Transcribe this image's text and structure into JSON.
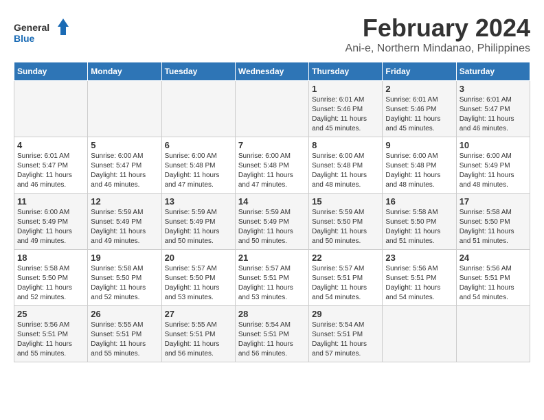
{
  "logo": {
    "text_general": "General",
    "text_blue": "Blue"
  },
  "title": "February 2024",
  "subtitle": "Ani-e, Northern Mindanao, Philippines",
  "calendar": {
    "headers": [
      "Sunday",
      "Monday",
      "Tuesday",
      "Wednesday",
      "Thursday",
      "Friday",
      "Saturday"
    ],
    "weeks": [
      {
        "days": [
          {
            "day": "",
            "info": ""
          },
          {
            "day": "",
            "info": ""
          },
          {
            "day": "",
            "info": ""
          },
          {
            "day": "",
            "info": ""
          },
          {
            "day": "1",
            "info": "Sunrise: 6:01 AM\nSunset: 5:46 PM\nDaylight: 11 hours\nand 45 minutes."
          },
          {
            "day": "2",
            "info": "Sunrise: 6:01 AM\nSunset: 5:46 PM\nDaylight: 11 hours\nand 45 minutes."
          },
          {
            "day": "3",
            "info": "Sunrise: 6:01 AM\nSunset: 5:47 PM\nDaylight: 11 hours\nand 46 minutes."
          }
        ]
      },
      {
        "days": [
          {
            "day": "4",
            "info": "Sunrise: 6:01 AM\nSunset: 5:47 PM\nDaylight: 11 hours\nand 46 minutes."
          },
          {
            "day": "5",
            "info": "Sunrise: 6:00 AM\nSunset: 5:47 PM\nDaylight: 11 hours\nand 46 minutes."
          },
          {
            "day": "6",
            "info": "Sunrise: 6:00 AM\nSunset: 5:48 PM\nDaylight: 11 hours\nand 47 minutes."
          },
          {
            "day": "7",
            "info": "Sunrise: 6:00 AM\nSunset: 5:48 PM\nDaylight: 11 hours\nand 47 minutes."
          },
          {
            "day": "8",
            "info": "Sunrise: 6:00 AM\nSunset: 5:48 PM\nDaylight: 11 hours\nand 48 minutes."
          },
          {
            "day": "9",
            "info": "Sunrise: 6:00 AM\nSunset: 5:48 PM\nDaylight: 11 hours\nand 48 minutes."
          },
          {
            "day": "10",
            "info": "Sunrise: 6:00 AM\nSunset: 5:49 PM\nDaylight: 11 hours\nand 48 minutes."
          }
        ]
      },
      {
        "days": [
          {
            "day": "11",
            "info": "Sunrise: 6:00 AM\nSunset: 5:49 PM\nDaylight: 11 hours\nand 49 minutes."
          },
          {
            "day": "12",
            "info": "Sunrise: 5:59 AM\nSunset: 5:49 PM\nDaylight: 11 hours\nand 49 minutes."
          },
          {
            "day": "13",
            "info": "Sunrise: 5:59 AM\nSunset: 5:49 PM\nDaylight: 11 hours\nand 50 minutes."
          },
          {
            "day": "14",
            "info": "Sunrise: 5:59 AM\nSunset: 5:49 PM\nDaylight: 11 hours\nand 50 minutes."
          },
          {
            "day": "15",
            "info": "Sunrise: 5:59 AM\nSunset: 5:50 PM\nDaylight: 11 hours\nand 50 minutes."
          },
          {
            "day": "16",
            "info": "Sunrise: 5:58 AM\nSunset: 5:50 PM\nDaylight: 11 hours\nand 51 minutes."
          },
          {
            "day": "17",
            "info": "Sunrise: 5:58 AM\nSunset: 5:50 PM\nDaylight: 11 hours\nand 51 minutes."
          }
        ]
      },
      {
        "days": [
          {
            "day": "18",
            "info": "Sunrise: 5:58 AM\nSunset: 5:50 PM\nDaylight: 11 hours\nand 52 minutes."
          },
          {
            "day": "19",
            "info": "Sunrise: 5:58 AM\nSunset: 5:50 PM\nDaylight: 11 hours\nand 52 minutes."
          },
          {
            "day": "20",
            "info": "Sunrise: 5:57 AM\nSunset: 5:50 PM\nDaylight: 11 hours\nand 53 minutes."
          },
          {
            "day": "21",
            "info": "Sunrise: 5:57 AM\nSunset: 5:51 PM\nDaylight: 11 hours\nand 53 minutes."
          },
          {
            "day": "22",
            "info": "Sunrise: 5:57 AM\nSunset: 5:51 PM\nDaylight: 11 hours\nand 54 minutes."
          },
          {
            "day": "23",
            "info": "Sunrise: 5:56 AM\nSunset: 5:51 PM\nDaylight: 11 hours\nand 54 minutes."
          },
          {
            "day": "24",
            "info": "Sunrise: 5:56 AM\nSunset: 5:51 PM\nDaylight: 11 hours\nand 54 minutes."
          }
        ]
      },
      {
        "days": [
          {
            "day": "25",
            "info": "Sunrise: 5:56 AM\nSunset: 5:51 PM\nDaylight: 11 hours\nand 55 minutes."
          },
          {
            "day": "26",
            "info": "Sunrise: 5:55 AM\nSunset: 5:51 PM\nDaylight: 11 hours\nand 55 minutes."
          },
          {
            "day": "27",
            "info": "Sunrise: 5:55 AM\nSunset: 5:51 PM\nDaylight: 11 hours\nand 56 minutes."
          },
          {
            "day": "28",
            "info": "Sunrise: 5:54 AM\nSunset: 5:51 PM\nDaylight: 11 hours\nand 56 minutes."
          },
          {
            "day": "29",
            "info": "Sunrise: 5:54 AM\nSunset: 5:51 PM\nDaylight: 11 hours\nand 57 minutes."
          },
          {
            "day": "",
            "info": ""
          },
          {
            "day": "",
            "info": ""
          }
        ]
      }
    ]
  }
}
